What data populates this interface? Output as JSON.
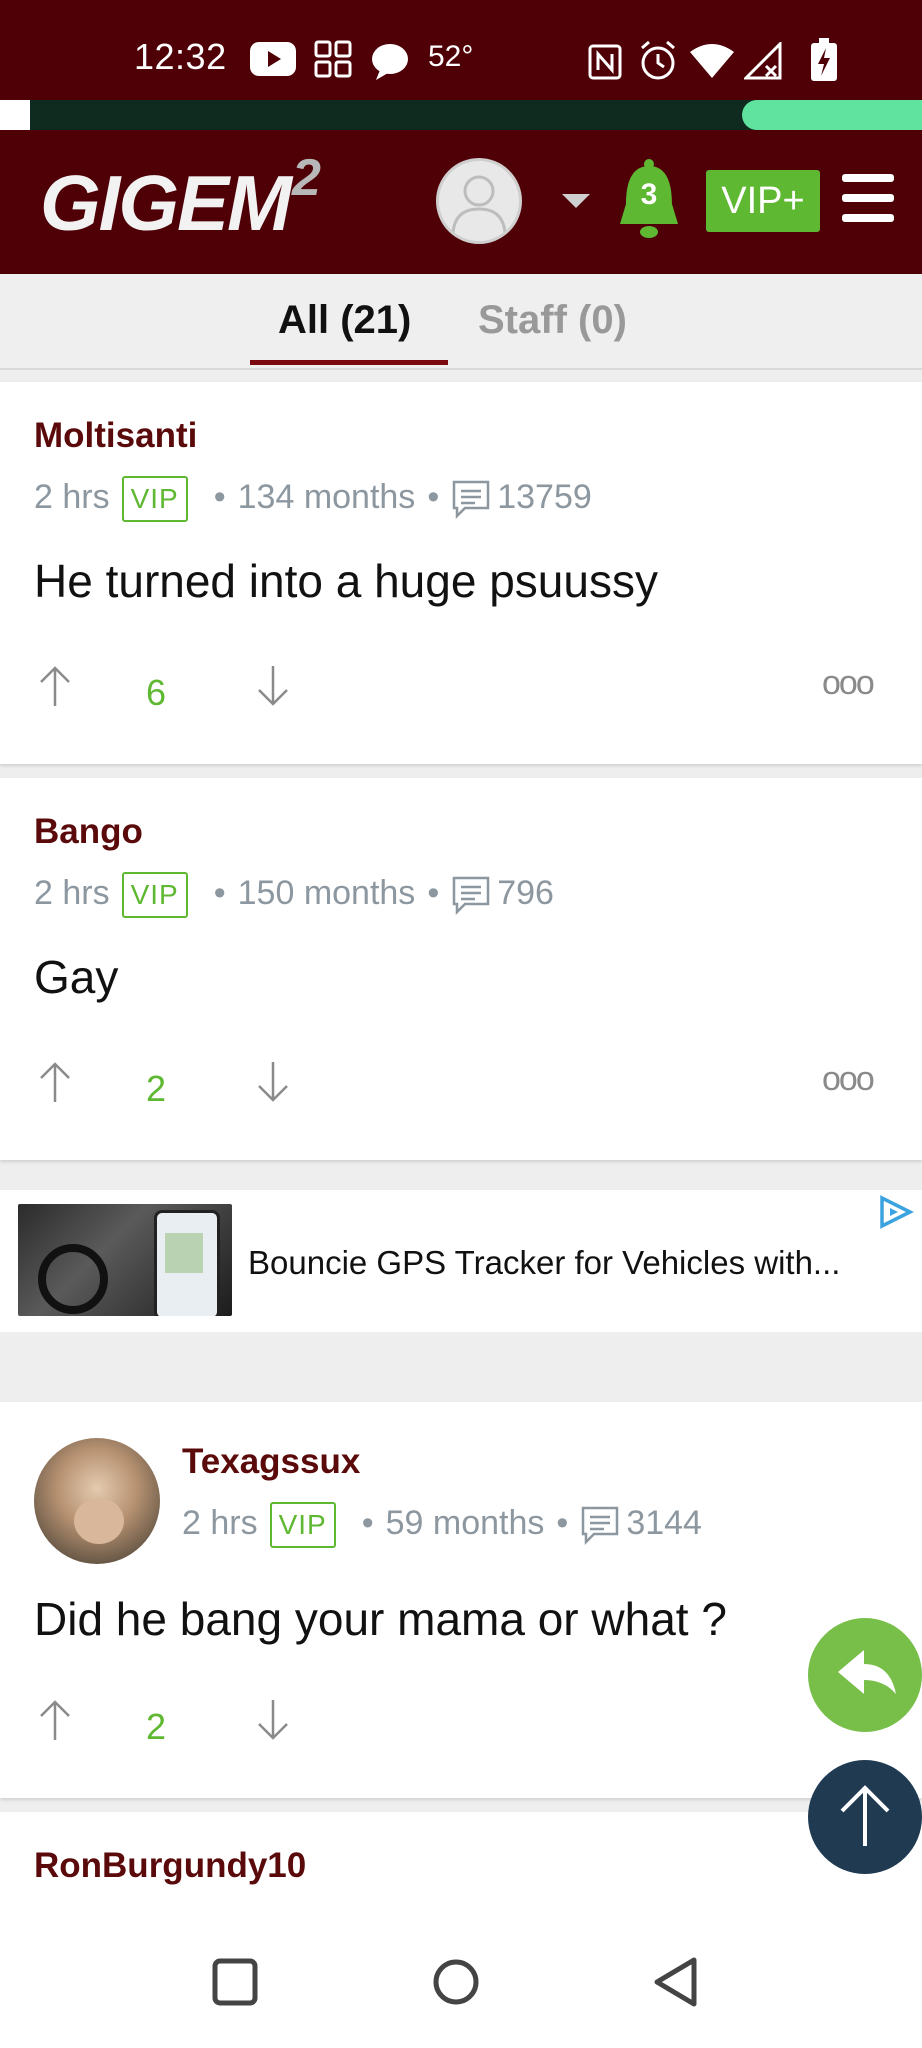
{
  "status_bar": {
    "time": "12:32",
    "temperature": "52°",
    "icons": [
      "youtube-icon",
      "app-grid-icon",
      "chat-bubble-icon",
      "nfc-icon",
      "alarm-icon",
      "wifi-icon",
      "signal-icon",
      "battery-charging-icon"
    ]
  },
  "header": {
    "logo": "GIGEM",
    "logo_superscript": "2",
    "notification_count": "3",
    "vip_label": "VIP+",
    "icons": [
      "avatar-icon",
      "caret-down-icon",
      "bell-icon",
      "hamburger-menu-icon"
    ]
  },
  "tabs": [
    {
      "label": "All (21)",
      "active": true
    },
    {
      "label": "Staff (0)",
      "active": false
    }
  ],
  "comments": [
    {
      "username": "Moltisanti",
      "time": "2 hrs",
      "badge": "VIP",
      "tenure": "134 months",
      "post_count": "13759",
      "text": "He turned into a huge psuussy",
      "votes": "6"
    },
    {
      "username": "Bango",
      "time": "2 hrs",
      "badge": "VIP",
      "tenure": "150 months",
      "post_count": "796",
      "text": "Gay",
      "votes": "2"
    },
    {
      "username": "Texagssux",
      "time": "2 hrs",
      "badge": "VIP",
      "tenure": "59 months",
      "post_count": "3144",
      "text": "Did he bang your mama or what ?",
      "votes": "2"
    },
    {
      "username": "RonBurgundy10"
    }
  ],
  "ad": {
    "text": "Bouncie GPS Tracker for Vehicles with..."
  },
  "separator": "•",
  "more_glyph": "ooo",
  "colors": {
    "brand": "#4e0006",
    "accent_green": "#5fb832",
    "username": "#5a0a0a",
    "meta_gray": "#8c97a0",
    "scroll_top_fab": "#203a52"
  }
}
